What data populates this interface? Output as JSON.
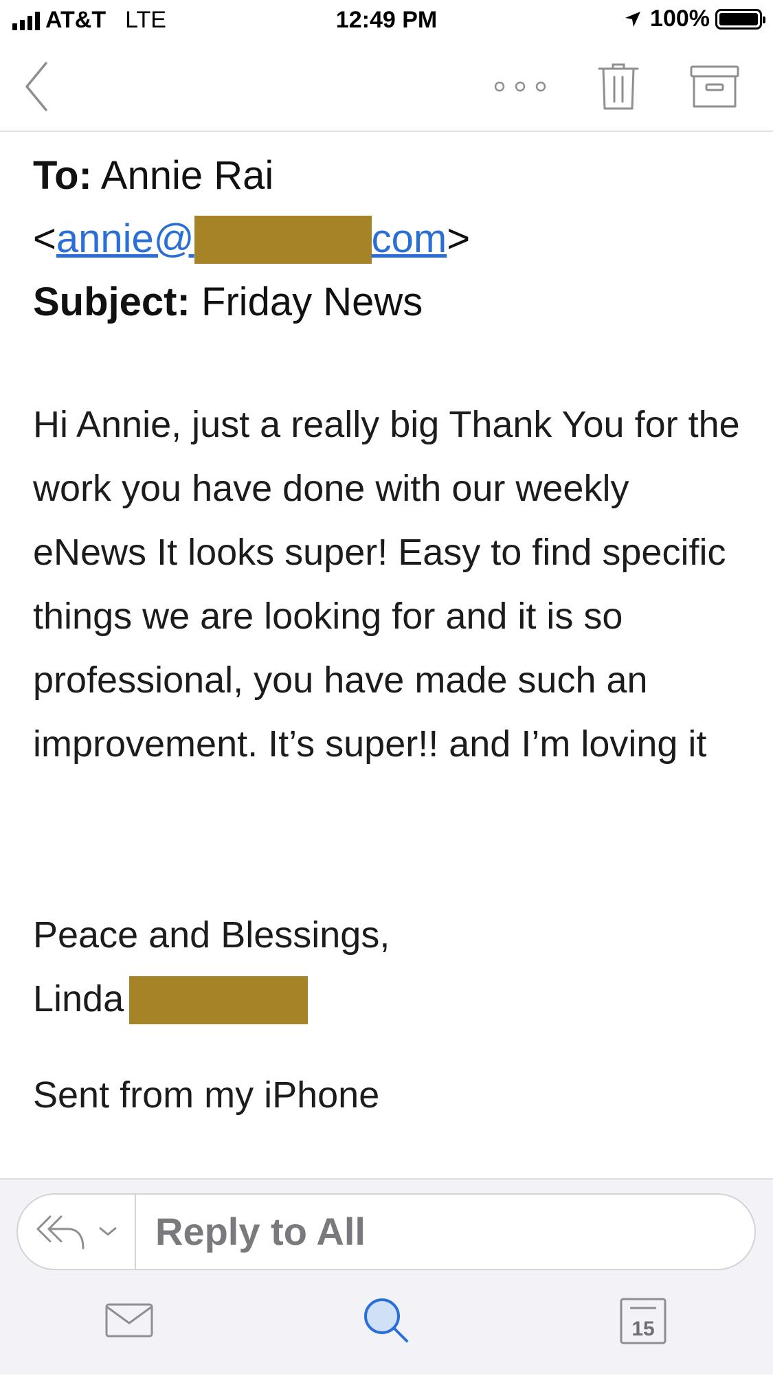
{
  "status_bar": {
    "carrier": "AT&T",
    "network": "LTE",
    "time": "12:49 PM",
    "battery": "100%",
    "battery_level": 1.0
  },
  "toolbar": {
    "back_icon": "chevron-left-icon",
    "more_icon": "more-dots-icon",
    "trash_icon": "trash-icon",
    "archive_icon": "archive-icon"
  },
  "email": {
    "to_label": "To:",
    "to_name": "Annie Rai",
    "to_open": "<",
    "to_email_start": "annie@",
    "to_email_end": "com",
    "to_close": ">",
    "subject_label": "Subject:",
    "subject": "Friday News",
    "body": "Hi Annie, just a really big Thank You for the work you have done with our weekly eNews It looks super! Easy to find specific things we are looking for and it is so professional, you have made such an improvement. It’s super!! and I’m loving it",
    "signoff_line": "Peace and Blessings,",
    "signature_name": "Linda",
    "sent_from": "Sent from my iPhone",
    "redaction_color": "#a58326",
    "link_color": "#2a6fd6"
  },
  "reply": {
    "text": "Reply to All",
    "reply_all_icon": "reply-all-icon",
    "dropdown_icon": "chevron-down-icon"
  },
  "tabbar": {
    "mail_icon": "mail-icon",
    "search_icon": "search-icon",
    "calendar_icon": "calendar-icon",
    "calendar_day": "15",
    "active_tab_color": "#2a6fd6"
  }
}
